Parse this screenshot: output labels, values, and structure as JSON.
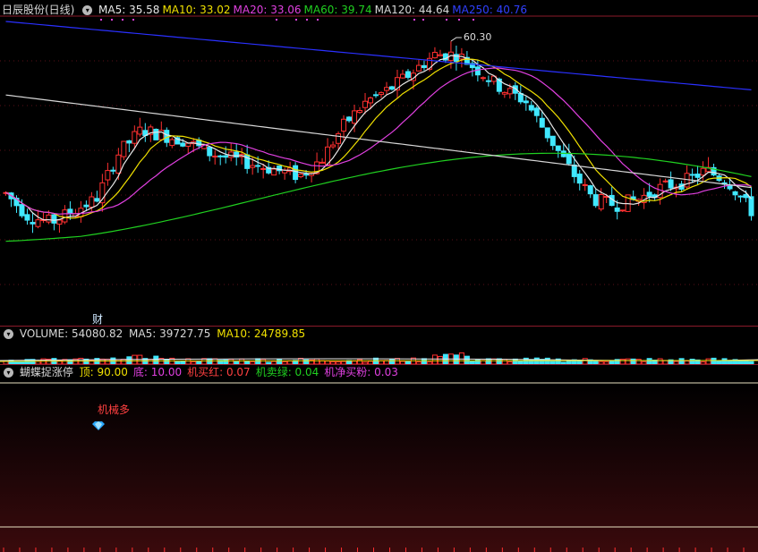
{
  "header": {
    "stock_name": "日辰股份(日线)",
    "ma": [
      {
        "label": "MA5:",
        "value": "35.58",
        "color": "#e8e8e8"
      },
      {
        "label": "MA10:",
        "value": "33.02",
        "color": "#f0e000"
      },
      {
        "label": "MA20:",
        "value": "33.06",
        "color": "#e040e0"
      },
      {
        "label": "MA60:",
        "value": "39.74",
        "color": "#20d020"
      },
      {
        "label": "MA120:",
        "value": "44.64",
        "color": "#d8d8d8"
      },
      {
        "label": "MA250:",
        "value": "40.76",
        "color": "#3040ff"
      }
    ]
  },
  "price_marks": {
    "high_label": "60.30",
    "event_tag": "财"
  },
  "volume": {
    "title": "VOLUME:",
    "value": "54080.82",
    "ma5_label": "MA5:",
    "ma5": "39727.75",
    "ma10_label": "MA10:",
    "ma10": "24789.85"
  },
  "indicator": {
    "name": "蝴蝶捉涨停",
    "items": [
      {
        "label": "顶:",
        "value": "90.00",
        "color": "#f0e000"
      },
      {
        "label": "底:",
        "value": "10.00",
        "color": "#e040e0"
      },
      {
        "label": "机买红:",
        "value": "0.07",
        "color": "#ff4040"
      },
      {
        "label": "机卖绿:",
        "value": "0.04",
        "color": "#20d020"
      },
      {
        "label": "机净买粉:",
        "value": "0.03",
        "color": "#e040e0"
      }
    ],
    "signal_label": "机械多"
  },
  "colors": {
    "up": "#ff3030",
    "down": "#40e8ff",
    "border": "#8b1a2a"
  },
  "chart_data": {
    "type": "candlestick",
    "high_marker": 60.3,
    "close_trend": [
      34,
      30,
      29,
      31,
      33,
      41,
      45,
      44,
      43,
      41,
      40,
      39,
      38,
      37,
      40,
      46,
      50,
      52,
      55,
      58,
      58,
      55,
      52,
      50,
      44,
      38,
      33,
      32,
      33,
      35,
      36,
      38,
      36,
      31
    ]
  }
}
